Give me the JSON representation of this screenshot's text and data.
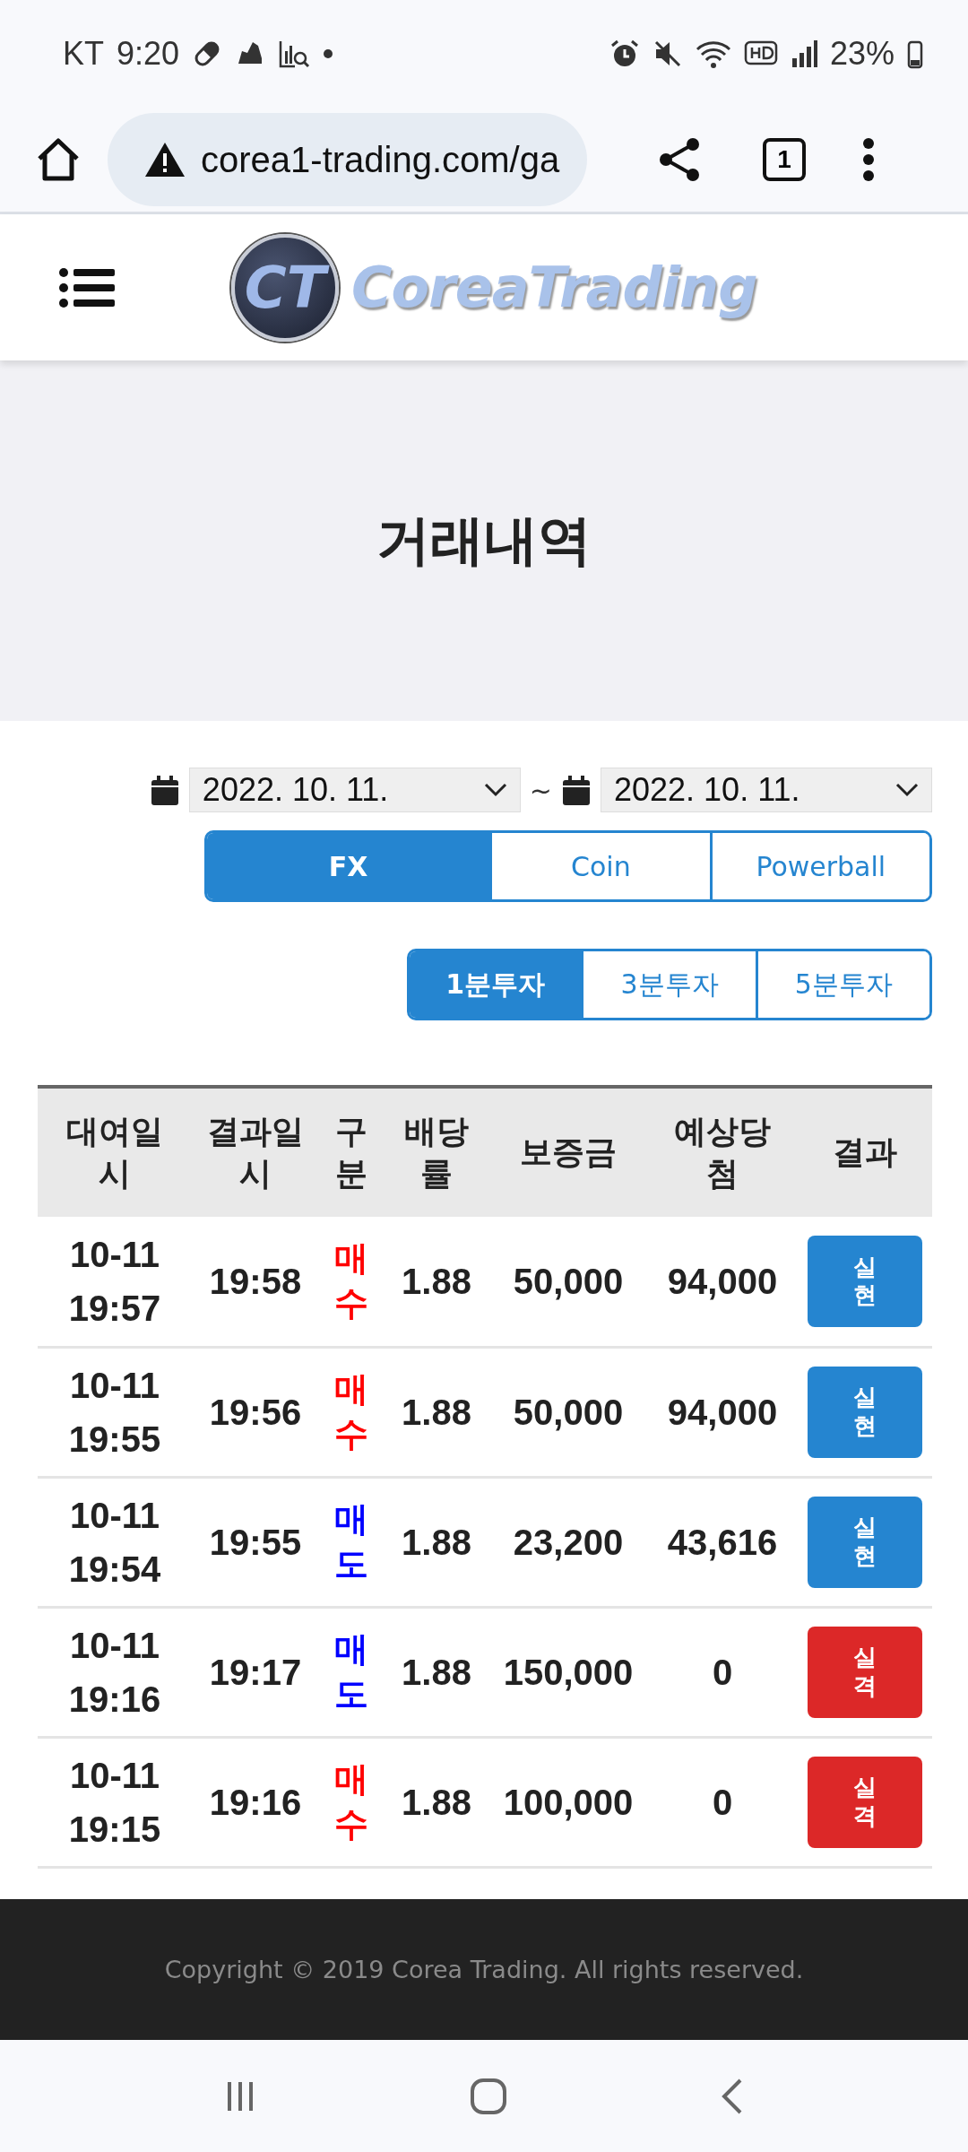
{
  "status_bar": {
    "carrier": "KT",
    "time": "9:20",
    "battery": "23%"
  },
  "browser": {
    "url": "corea1-trading.com/ga",
    "tab_count": "1"
  },
  "header": {
    "logo_mark": "CT",
    "logo_text": "CoreaTrading"
  },
  "hero": {
    "title": "거래내역"
  },
  "filters": {
    "date_from": "2022. 10. 11.",
    "separator": "~",
    "date_to": "2022. 10. 11.",
    "markets": [
      {
        "label": "FX",
        "selected": true
      },
      {
        "label": "Coin",
        "selected": false
      },
      {
        "label": "Powerball",
        "selected": false
      }
    ],
    "durations": [
      {
        "label": "1분투자",
        "selected": true
      },
      {
        "label": "3분투자",
        "selected": false
      },
      {
        "label": "5분투자",
        "selected": false
      }
    ]
  },
  "table": {
    "columns": [
      "대여일시",
      "결과일시",
      "구분",
      "배당률",
      "보증금",
      "예상당첨",
      "결과"
    ],
    "rows": [
      {
        "start": "10-11 19:57",
        "end": "19:58",
        "side": {
          "label": "매수",
          "color": "#ff0000"
        },
        "rate": "1.88",
        "deposit": "50,000",
        "expected": "94,000",
        "result": {
          "label": "실현",
          "color": "#2585d0"
        }
      },
      {
        "start": "10-11 19:55",
        "end": "19:56",
        "side": {
          "label": "매수",
          "color": "#ff0000"
        },
        "rate": "1.88",
        "deposit": "50,000",
        "expected": "94,000",
        "result": {
          "label": "실현",
          "color": "#2585d0"
        }
      },
      {
        "start": "10-11 19:54",
        "end": "19:55",
        "side": {
          "label": "매도",
          "color": "#0000ff"
        },
        "rate": "1.88",
        "deposit": "23,200",
        "expected": "43,616",
        "result": {
          "label": "실현",
          "color": "#2585d0"
        }
      },
      {
        "start": "10-11 19:16",
        "end": "19:17",
        "side": {
          "label": "매도",
          "color": "#0000ff"
        },
        "rate": "1.88",
        "deposit": "150,000",
        "expected": "0",
        "result": {
          "label": "실격",
          "color": "#dc2828"
        }
      },
      {
        "start": "10-11 19:15",
        "end": "19:16",
        "side": {
          "label": "매수",
          "color": "#ff0000"
        },
        "rate": "1.88",
        "deposit": "100,000",
        "expected": "0",
        "result": {
          "label": "실격",
          "color": "#dc2828"
        }
      }
    ]
  },
  "footer": {
    "copyright": "Copyright © 2019 Corea Trading. All rights reserved."
  }
}
